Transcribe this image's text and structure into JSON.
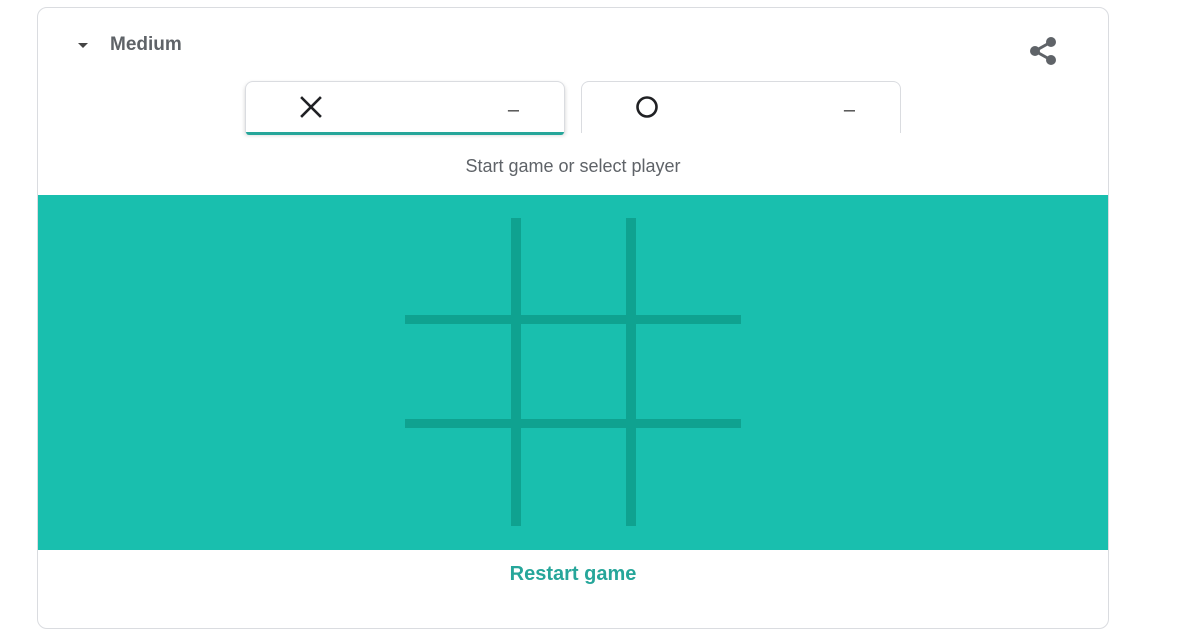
{
  "header": {
    "difficulty": "Medium",
    "share_icon": "share-icon"
  },
  "players": {
    "x": {
      "symbol_icon": "x-mark-icon",
      "score": "–",
      "active": true
    },
    "o": {
      "symbol_icon": "o-circle-icon",
      "score": "–",
      "active": false
    }
  },
  "status": "Start game or select player",
  "board": {
    "cells": [
      "",
      "",
      "",
      "",
      "",
      "",
      "",
      "",
      ""
    ]
  },
  "restart_label": "Restart game",
  "colors": {
    "board_bg": "#19bfae",
    "grid_line": "#0fa290",
    "accent": "#26a69a"
  }
}
